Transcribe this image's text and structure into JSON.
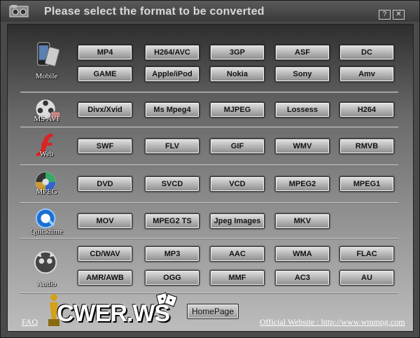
{
  "window": {
    "title": "Please select the format to be converted",
    "help_label": "?",
    "close_label": "✕"
  },
  "groups": [
    {
      "key": "mobile",
      "label": "Mobile",
      "icon": "mobile-phone-icon",
      "rows": [
        [
          "MP4",
          "H264/AVC",
          "3GP",
          "ASF",
          "DC"
        ],
        [
          "GAME",
          "Apple/iPod",
          "Nokia",
          "Sony",
          "Amv"
        ]
      ]
    },
    {
      "key": "msavi",
      "label": "MS AVI",
      "icon": "film-reel-icon",
      "rows": [
        [
          "Divx/Xvid",
          "Ms Mpeg4",
          "MJPEG",
          "Lossess",
          "H264"
        ]
      ]
    },
    {
      "key": "web",
      "label": "Web",
      "icon": "flash-icon",
      "rows": [
        [
          "SWF",
          "FLV",
          "GIF",
          "WMV",
          "RMVB"
        ]
      ]
    },
    {
      "key": "mpeg",
      "label": "MPEG",
      "icon": "disc-icon",
      "rows": [
        [
          "DVD",
          "SVCD",
          "VCD",
          "MPEG2",
          "MPEG1"
        ]
      ]
    },
    {
      "key": "quicktime",
      "label": "Quicktime",
      "icon": "quicktime-icon",
      "rows": [
        [
          "MOV",
          "MPEG2 TS",
          "Jpeg Images",
          "MKV"
        ]
      ]
    },
    {
      "key": "audio",
      "label": "Audio",
      "icon": "napster-cat-icon",
      "rows": [
        [
          "CD/WAV",
          "MP3",
          "AAC",
          "WMA",
          "FLAC"
        ],
        [
          "AMR/AWB",
          "OGG",
          "MMF",
          "AC3",
          "AU"
        ]
      ]
    }
  ],
  "footer": {
    "faq": "FAQ",
    "logo_text": "CWER.WS",
    "homepage": "HomePage",
    "website": "Official Website : http://www.winmpg.com"
  }
}
